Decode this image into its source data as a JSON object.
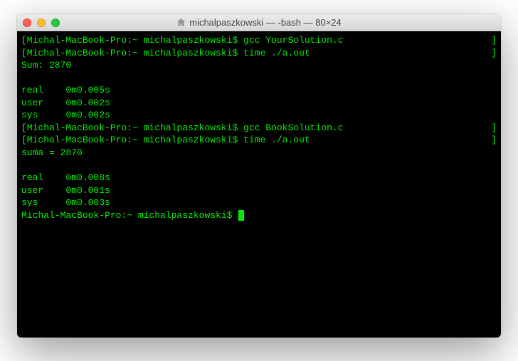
{
  "window": {
    "title": "michalpaszkowski — -bash — 80×24"
  },
  "terminal": {
    "lines": [
      {
        "type": "prompt",
        "bracketed": true,
        "host": "Michal-MacBook-Pro:~",
        "user": "michalpaszkowski$",
        "cmd": "gcc YourSolution.c"
      },
      {
        "type": "prompt",
        "bracketed": true,
        "host": "Michal-MacBook-Pro:~",
        "user": "michalpaszkowski$",
        "cmd": "time ./a.out"
      },
      {
        "type": "output",
        "text": "Sum: 2870"
      },
      {
        "type": "output",
        "text": ""
      },
      {
        "type": "output",
        "text": "real    0m0.005s"
      },
      {
        "type": "output",
        "text": "user    0m0.002s"
      },
      {
        "type": "output",
        "text": "sys     0m0.002s"
      },
      {
        "type": "prompt",
        "bracketed": true,
        "host": "Michal-MacBook-Pro:~",
        "user": "michalpaszkowski$",
        "cmd": "gcc BookSolution.c"
      },
      {
        "type": "prompt",
        "bracketed": true,
        "host": "Michal-MacBook-Pro:~",
        "user": "michalpaszkowski$",
        "cmd": "time ./a.out"
      },
      {
        "type": "output",
        "text": "suma = 2870"
      },
      {
        "type": "output",
        "text": ""
      },
      {
        "type": "output",
        "text": "real    0m0.008s"
      },
      {
        "type": "output",
        "text": "user    0m0.001s"
      },
      {
        "type": "output",
        "text": "sys     0m0.003s"
      },
      {
        "type": "prompt",
        "bracketed": false,
        "host": "Michal-MacBook-Pro:~",
        "user": "michalpaszkowski$",
        "cmd": "",
        "cursor": true
      }
    ]
  },
  "colors": {
    "terminal_bg": "#000000",
    "terminal_fg": "#00e600"
  }
}
